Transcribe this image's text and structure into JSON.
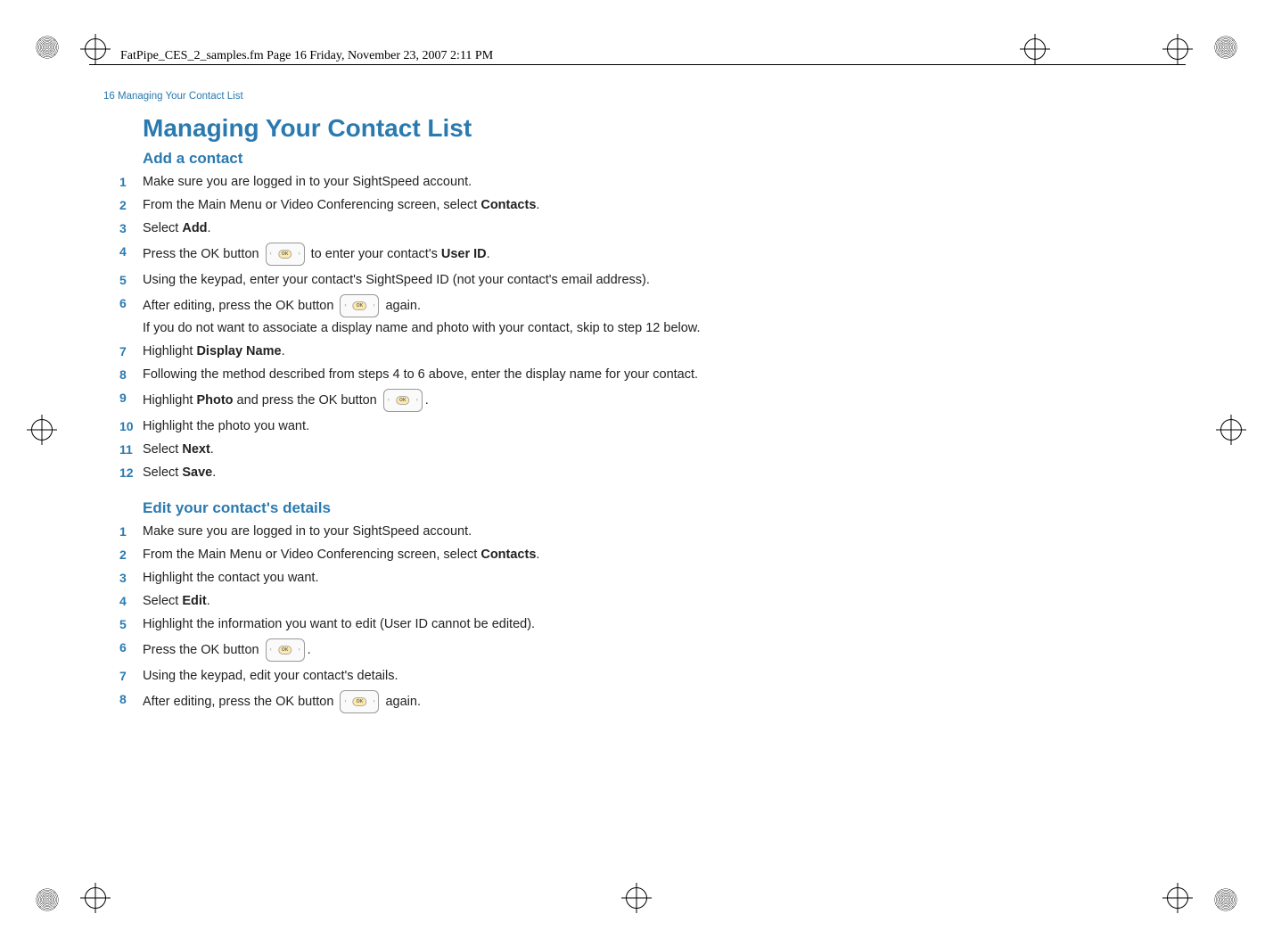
{
  "header": {
    "framemaker_line": "FatPipe_CES_2_samples.fm  Page 16  Friday, November 23, 2007  2:11 PM"
  },
  "running_head": "16  Managing Your Contact List",
  "title": "Managing Your Contact List",
  "sections": {
    "add": {
      "heading": "Add a contact",
      "s1": "Make sure you are logged in to your SightSpeed account.",
      "s2a": "From the Main Menu or Video Conferencing screen, select ",
      "s2b": "Contacts",
      "s2c": ".",
      "s3a": "Select ",
      "s3b": "Add",
      "s3c": ".",
      "s4a": "Press the OK button ",
      "s4b": " to enter your contact's ",
      "s4c": "User ID",
      "s4d": ".",
      "s5": "Using the keypad, enter your contact's SightSpeed ID (not your contact's email address).",
      "s6a": "After editing, press the OK button ",
      "s6b": " again.",
      "s6sub": "If you do not want to associate a display name and photo with your contact, skip to step 12 below.",
      "s7a": "Highlight ",
      "s7b": "Display Name",
      "s7c": ".",
      "s8": "Following the method described from steps 4 to 6 above, enter the display name for your contact.",
      "s9a": "Highlight ",
      "s9b": "Photo",
      "s9c": " and press the OK button ",
      "s9d": ".",
      "s10": "Highlight the photo you want.",
      "s11a": "Select ",
      "s11b": "Next",
      "s11c": ".",
      "s12a": "Select ",
      "s12b": "Save",
      "s12c": "."
    },
    "edit": {
      "heading": "Edit your contact's details",
      "s1": "Make sure you are logged in to your SightSpeed account.",
      "s2a": "From the Main Menu or Video Conferencing screen, select ",
      "s2b": "Contacts",
      "s2c": ".",
      "s3": "Highlight the contact you want.",
      "s4a": "Select ",
      "s4b": "Edit",
      "s4c": ".",
      "s5": "Highlight the information you want to edit (User ID cannot be edited).",
      "s6a": "Press the OK button ",
      "s6b": ".",
      "s7": "Using the keypad, edit your contact's details.",
      "s8a": "After editing, press the OK button ",
      "s8b": " again."
    }
  },
  "nums": {
    "n1": "1",
    "n2": "2",
    "n3": "3",
    "n4": "4",
    "n5": "5",
    "n6": "6",
    "n7": "7",
    "n8": "8",
    "n9": "9",
    "n10": "10",
    "n11": "11",
    "n12": "12"
  },
  "ok_label": "OK"
}
